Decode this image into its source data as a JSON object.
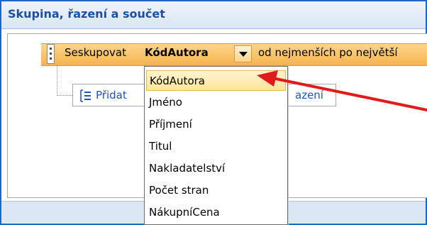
{
  "pane": {
    "title": "Skupina, řazení a součet"
  },
  "group_row": {
    "prefix": "Seskupovat",
    "field": "KódAutora",
    "order": "od nejmenších po největší"
  },
  "add_sort": {
    "label_head": "Přidat",
    "label_tail": "azení"
  },
  "dropdown": {
    "selected": "KódAutora",
    "items": [
      {
        "label": "KódAutora"
      },
      {
        "label": "Jméno"
      },
      {
        "label": "Příjmení"
      },
      {
        "label": "Titul"
      },
      {
        "label": "Nakladatelství"
      },
      {
        "label": "Počet stran"
      },
      {
        "label": "NákupníCena"
      }
    ]
  },
  "annotation": {
    "arrow_color": "#e11b1b"
  },
  "colors": {
    "accent": "#1e66c8",
    "group_row": "#f6b34f",
    "selection": "#ffe49a"
  }
}
